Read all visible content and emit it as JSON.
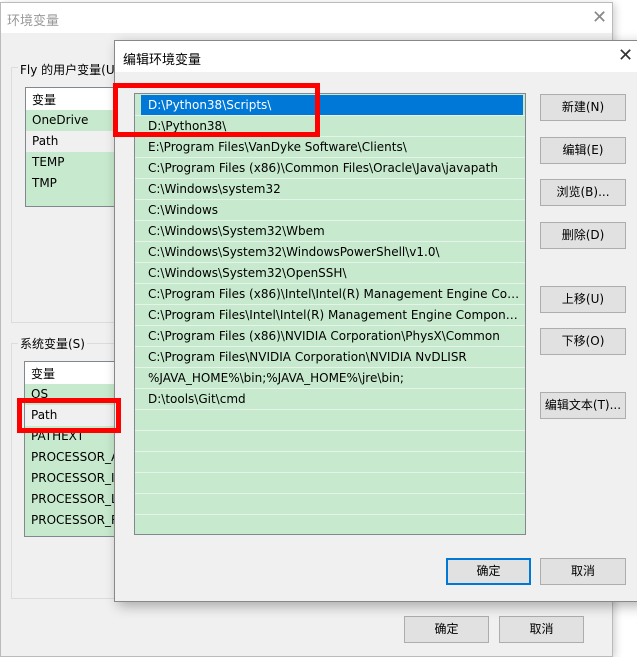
{
  "back_window": {
    "title": "环境变量",
    "user_group_label": "Fly 的用户变量(U)",
    "user_list_header": "变量",
    "user_vars": [
      "OneDrive",
      "Path",
      "TEMP",
      "TMP"
    ],
    "system_group_label": "系统变量(S)",
    "system_list_header": "变量",
    "system_vars": [
      "OS",
      "Path",
      "PATHEXT",
      "PROCESSOR_A",
      "PROCESSOR_ID",
      "PROCESSOR_L",
      "PROCESSOR_R"
    ],
    "ok_label": "确定",
    "cancel_label": "取消"
  },
  "dialog": {
    "title": "编辑环境变量",
    "paths": [
      "D:\\Python38\\Scripts\\",
      "D:\\Python38\\",
      "E:\\Program Files\\VanDyke Software\\Clients\\",
      "C:\\Program Files (x86)\\Common Files\\Oracle\\Java\\javapath",
      "C:\\Windows\\system32",
      "C:\\Windows",
      "C:\\Windows\\System32\\Wbem",
      "C:\\Windows\\System32\\WindowsPowerShell\\v1.0\\",
      "C:\\Windows\\System32\\OpenSSH\\",
      "C:\\Program Files (x86)\\Intel\\Intel(R) Management Engine Comp...",
      "C:\\Program Files\\Intel\\Intel(R) Management Engine Component...",
      "C:\\Program Files (x86)\\NVIDIA Corporation\\PhysX\\Common",
      "C:\\Program Files\\NVIDIA Corporation\\NVIDIA NvDLISR",
      "%JAVA_HOME%\\bin;%JAVA_HOME%\\jre\\bin;",
      "D:\\tools\\Git\\cmd"
    ],
    "selected_index": 0,
    "buttons": {
      "new": "新建(N)",
      "edit": "编辑(E)",
      "browse": "浏览(B)...",
      "delete": "删除(D)",
      "move_up": "上移(U)",
      "move_down": "下移(O)",
      "edit_text": "编辑文本(T)..."
    },
    "ok_label": "确定",
    "cancel_label": "取消"
  },
  "colors": {
    "highlight": "#ff0000",
    "selection": "#0078d7",
    "row_bg": "#c7e9cd"
  }
}
